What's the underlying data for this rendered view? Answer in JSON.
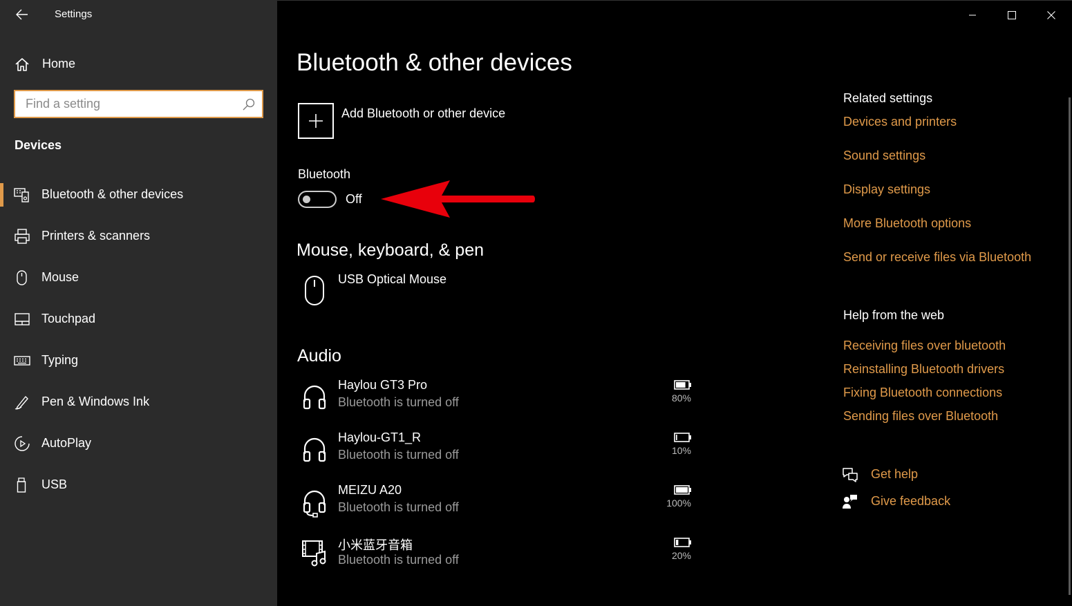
{
  "window": {
    "title": "Settings",
    "accent_color": "#e09a4a",
    "controls": [
      "minimize-icon",
      "maximize-icon",
      "close-icon"
    ]
  },
  "sidebar": {
    "home_label": "Home",
    "search_placeholder": "Find a setting",
    "section_title": "Devices",
    "items": [
      {
        "label": "Bluetooth & other devices",
        "icon": "bluetooth-devices-icon",
        "active": true
      },
      {
        "label": "Printers & scanners",
        "icon": "printer-icon"
      },
      {
        "label": "Mouse",
        "icon": "mouse-icon"
      },
      {
        "label": "Touchpad",
        "icon": "touchpad-icon"
      },
      {
        "label": "Typing",
        "icon": "keyboard-icon"
      },
      {
        "label": "Pen & Windows Ink",
        "icon": "pen-icon"
      },
      {
        "label": "AutoPlay",
        "icon": "autoplay-icon"
      },
      {
        "label": "USB",
        "icon": "usb-icon"
      }
    ]
  },
  "main": {
    "title": "Bluetooth & other devices",
    "add_device_label": "Add Bluetooth or other device",
    "bluetooth": {
      "label": "Bluetooth",
      "state": "Off",
      "on": false
    },
    "mouse_section": {
      "title": "Mouse, keyboard, & pen",
      "devices": [
        {
          "name": "USB Optical Mouse",
          "icon": "mouse-icon"
        }
      ]
    },
    "audio_section": {
      "title": "Audio",
      "devices": [
        {
          "name": "Haylou GT3 Pro",
          "status": "Bluetooth is turned off",
          "battery": "80%",
          "battery_level": 0.8,
          "icon": "headphones-icon"
        },
        {
          "name": "Haylou-GT1_R",
          "status": "Bluetooth is turned off",
          "battery": "10%",
          "battery_level": 0.1,
          "icon": "headphones-icon"
        },
        {
          "name": "MEIZU A20",
          "status": "Bluetooth is turned off",
          "battery": "100%",
          "battery_level": 1.0,
          "icon": "headset-icon"
        },
        {
          "name": "小米蓝牙音箱",
          "status": "Bluetooth is turned off",
          "battery": "20%",
          "battery_level": 0.2,
          "icon": "speaker-media-icon"
        }
      ]
    }
  },
  "related": {
    "title": "Related settings",
    "links": [
      "Devices and printers",
      "Sound settings",
      "Display settings",
      "More Bluetooth options",
      "Send or receive files via Bluetooth"
    ]
  },
  "help": {
    "title": "Help from the web",
    "links": [
      "Receiving files over bluetooth",
      "Reinstalling Bluetooth drivers",
      "Fixing Bluetooth connections",
      "Sending files over Bluetooth"
    ],
    "get_help": "Get help",
    "give_feedback": "Give feedback"
  }
}
